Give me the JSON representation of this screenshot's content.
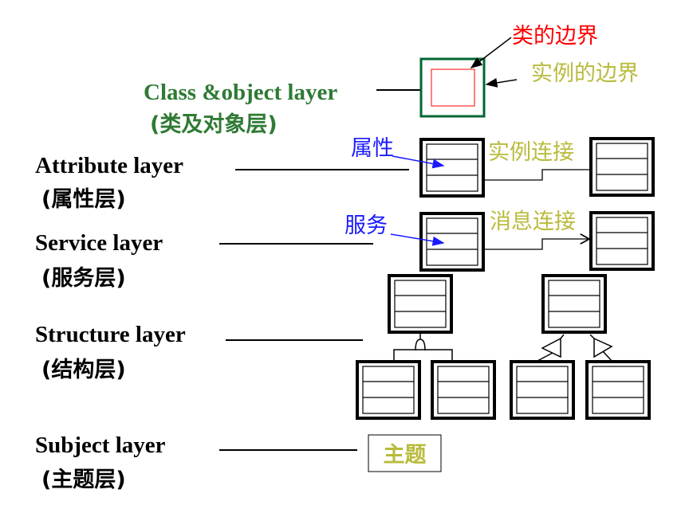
{
  "colors": {
    "green": "#2f7a34",
    "box_green": "#006633",
    "red": "#ff0000",
    "olive": "#b8bb3c",
    "blue": "#1a1aff",
    "black": "#000000"
  },
  "layers": [
    {
      "name": "Class &object layer",
      "cn": "(类及对象层)"
    },
    {
      "name": "Attribute layer",
      "cn": "(属性层)"
    },
    {
      "name": "Service layer",
      "cn": "(服务层)"
    },
    {
      "name": "Structure layer",
      "cn": "(结构层)"
    },
    {
      "name": "Subject layer",
      "cn": "(主题层)"
    }
  ],
  "annotations": {
    "class_boundary": "类的边界",
    "instance_boundary": "实例的边界",
    "attribute": "属性",
    "instance_connection": "实例连接",
    "service": "服务",
    "message_connection": "消息连接",
    "subject": "主题"
  }
}
